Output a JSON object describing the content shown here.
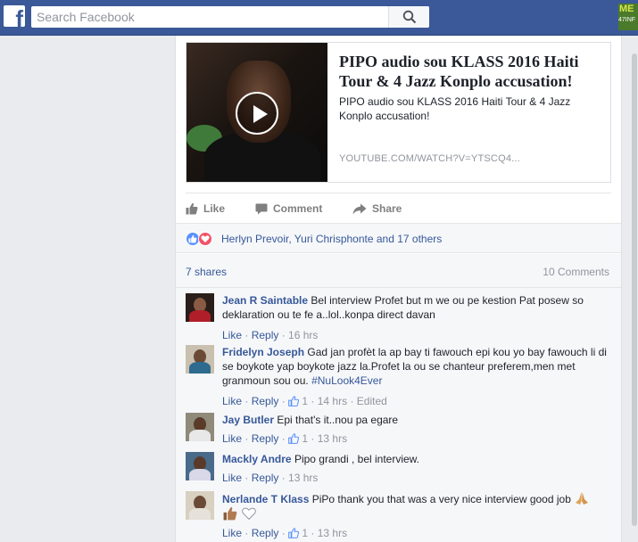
{
  "topbar": {
    "logo_letter": "f",
    "search_placeholder": "Search Facebook",
    "corner_badge_line1": "ME",
    "corner_badge_line2": "47INF"
  },
  "post": {
    "link": {
      "title": "PIPO audio sou KLASS 2016 Haiti Tour & 4 Jazz Konplo accusation!",
      "description": "PIPO audio sou KLASS 2016 Haiti Tour & 4 Jazz Konplo accusation!",
      "domain": "YOUTUBE.COM/WATCH?V=YTSCQ4..."
    },
    "actions": {
      "like": "Like",
      "comment": "Comment",
      "share": "Share"
    },
    "reactions_text": "Herlyn Prevoir, Yuri Chrisphonte and 17 others",
    "shares_text": "7 shares",
    "comments_count_text": "10 Comments"
  },
  "comments": [
    {
      "author": "Jean R Saintable",
      "text": "Bel interview Profet but m we ou pe kestion Pat posew so deklaration ou te fe a..lol..konpa direct davan",
      "like_label": "Like",
      "reply_label": "Reply",
      "time": "16 hrs",
      "likes": "",
      "edited": ""
    },
    {
      "author": "Fridelyn Joseph",
      "text": "Gad jan profèt la ap bay ti fawouch epi kou yo bay fawouch li di se boykote yap boykote jazz la.Profet la ou se chanteur preferem,men met granmoun sou ou.",
      "hashtag": "#NuLook4Ever",
      "like_label": "Like",
      "reply_label": "Reply",
      "likes": "1",
      "time": "14 hrs",
      "edited": "Edited"
    },
    {
      "author": "Jay Butler",
      "text": "Epi that's it..nou pa egare",
      "like_label": "Like",
      "reply_label": "Reply",
      "likes": "1",
      "time": "13 hrs"
    },
    {
      "author": "Mackly Andre",
      "text": "Pipo grandi , bel interview.",
      "like_label": "Like",
      "reply_label": "Reply",
      "time": "13 hrs"
    },
    {
      "author": "Nerlande T Klass",
      "text": "PiPo thank you that was a very nice interview good job",
      "like_label": "Like",
      "reply_label": "Reply",
      "likes": "1",
      "time": "13 hrs"
    }
  ],
  "colors": {
    "brand": "#3b5998",
    "link": "#365899",
    "meta": "#90949c",
    "like_reaction": "#5890ff",
    "love_reaction": "#f25268"
  },
  "icons": [
    "facebook-logo-icon",
    "search-icon",
    "play-icon",
    "like-thumb-icon",
    "comment-icon",
    "share-arrow-icon",
    "heart-icon",
    "praying-hands-emoji",
    "thumbs-up-emoji",
    "white-heart-emoji"
  ]
}
